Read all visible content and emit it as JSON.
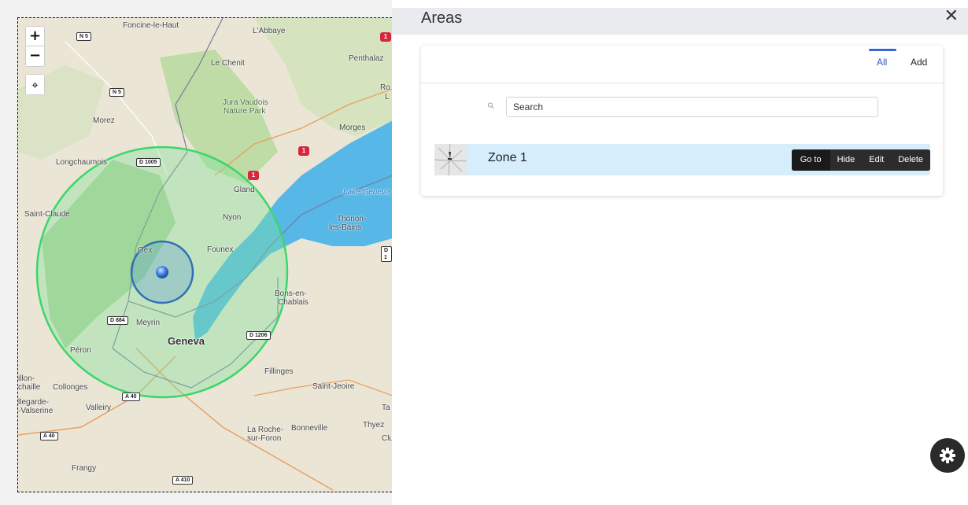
{
  "map": {
    "zoom_in": "+",
    "zoom_out": "−",
    "locate_symbol": "⌖",
    "labels": {
      "foncine": "Foncine-le-Haut",
      "labbaye": "L'Abbaye",
      "penthalaz": "Penthalaz",
      "lechenit": "Le Chenit",
      "ro": "Ro",
      "l": "L",
      "jura": "Jura Vaudois",
      "naturepark": "Nature Park",
      "morez": "Morez",
      "morges": "Morges",
      "longchaumois": "Longchaumois",
      "gland": "Gland",
      "lakegeneva": "Lake Geneva",
      "saintclaude": "Saint-Claude",
      "nyon": "Nyon",
      "thonon": "Thonon-",
      "lesbains": "les-Bains",
      "gex": "Gex",
      "founex": "Founex",
      "bonsen": "Bons-en-",
      "chablais": "Chablais",
      "meyrin": "Meyrin",
      "geneva": "Geneva",
      "peron": "Péron",
      "fillinges": "Fillinges",
      "illon": "illon-",
      "chaille": "chaille",
      "collonges": "Collonges",
      "saintjeoire": "Saint-Jeoire",
      "llegarde": "llegarde-",
      "valserine": "-Valserine",
      "valleiry": "Valleiry",
      "ta": "Ta",
      "larochesur": "La Roche-",
      "surforon": "sur-Foron",
      "bonneville": "Bonneville",
      "thyez": "Thyez",
      "clu": "Clu",
      "frangy": "Frangy"
    },
    "shields": {
      "n5a": "N 5",
      "n5b": "N 5",
      "d1005": "D 1005",
      "d884": "D 884",
      "d1206": "D 1206",
      "a40a": "A 40",
      "a40b": "A 40",
      "a410": "A 410",
      "d1": "D 1",
      "r1": "1"
    }
  },
  "panel": {
    "title": "Areas",
    "close": "✕",
    "tabs": {
      "all": "All",
      "add": "Add"
    },
    "search": {
      "icon": "⚲",
      "placeholder": "Search",
      "value": ""
    },
    "zones": [
      {
        "name": "Zone 1",
        "actions": {
          "goto": "Go to",
          "hide": "Hide",
          "edit": "Edit",
          "delete": "Delete"
        }
      }
    ]
  },
  "colors": {
    "accent_tab": "#3a64d8",
    "row_highlight": "#d6edfc",
    "outer_circle": "#3cd66b",
    "inner_circle": "#2f6fb6",
    "lake": "#57b8e8"
  }
}
